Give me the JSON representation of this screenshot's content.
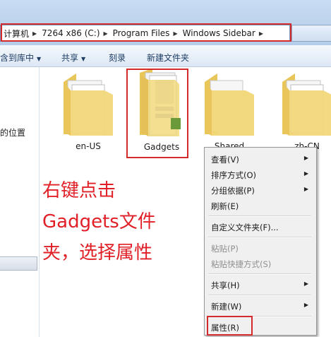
{
  "address_bar": {
    "crumbs": [
      "计算机",
      "7264 x86 (C:)",
      "Program Files",
      "Windows Sidebar"
    ]
  },
  "toolbar": {
    "include_in_library": "含到库中",
    "share": "共享",
    "burn": "刻录",
    "new_folder": "新建文件夹"
  },
  "nav_pane": {
    "location_label": "的位置"
  },
  "files": [
    {
      "name": "en-US"
    },
    {
      "name": "Gadgets"
    },
    {
      "name": "Shared"
    },
    {
      "name": "zh-CN"
    }
  ],
  "annotation": {
    "lines": [
      "右键点击",
      "Gadgets文件",
      "夹，选择属性"
    ]
  },
  "context_menu": {
    "view": "查看(V)",
    "sort_by": "排序方式(O)",
    "group_by": "分组依据(P)",
    "refresh": "刷新(E)",
    "customize_folder": "自定义文件夹(F)...",
    "paste": "粘贴(P)",
    "paste_shortcut": "粘贴快捷方式(S)",
    "share_with": "共享(H)",
    "new": "新建(W)",
    "properties": "属性(R)"
  },
  "colors": {
    "highlight_red": "#d42a2a",
    "annotation_red": "#e01f26",
    "folder_yellow": "#f2d777"
  }
}
